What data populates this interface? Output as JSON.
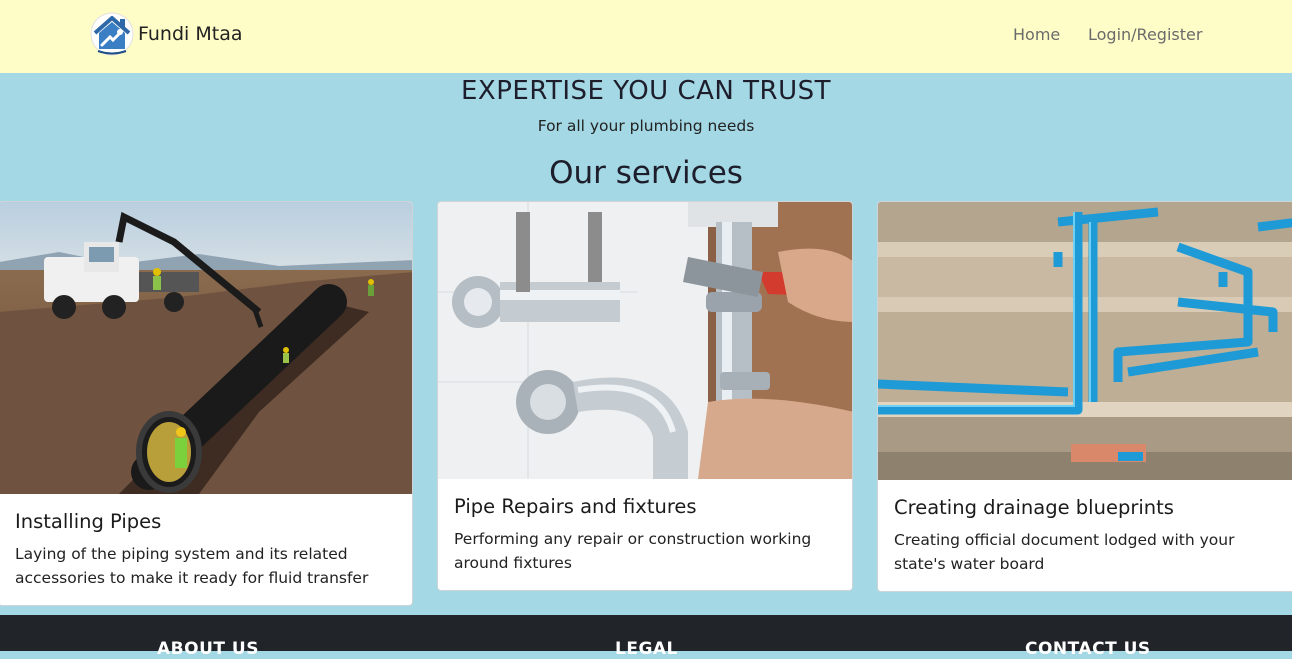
{
  "brand": {
    "name": "Fundi Mtaa",
    "logo_icon": "house-wrench-logo-icon"
  },
  "nav": {
    "home": "Home",
    "login": "Login/Register"
  },
  "hero": {
    "title": "EXPERTISE YOU CAN TRUST",
    "subtitle": "For all your plumbing needs"
  },
  "services": {
    "heading": "Our services",
    "cards": [
      {
        "title": "Installing Pipes",
        "text": "Laying of the piping system and its related accessories to make it ready for fluid transfer",
        "image_icon": "pipe-installation-photo"
      },
      {
        "title": "Pipe Repairs and fixtures",
        "text": "Performing any repair or construction working around fixtures",
        "image_icon": "pipe-repair-photo"
      },
      {
        "title": "Creating drainage blueprints",
        "text": "Creating official document lodged with your state's water board",
        "image_icon": "drainage-pipes-photo"
      }
    ]
  },
  "footer": {
    "about": "ABOUT US",
    "legal": "LEGAL",
    "contact": "CONTACT US"
  },
  "colors": {
    "navbar": "#fefdc8",
    "background": "#a3d8e4",
    "footer": "#212529"
  }
}
